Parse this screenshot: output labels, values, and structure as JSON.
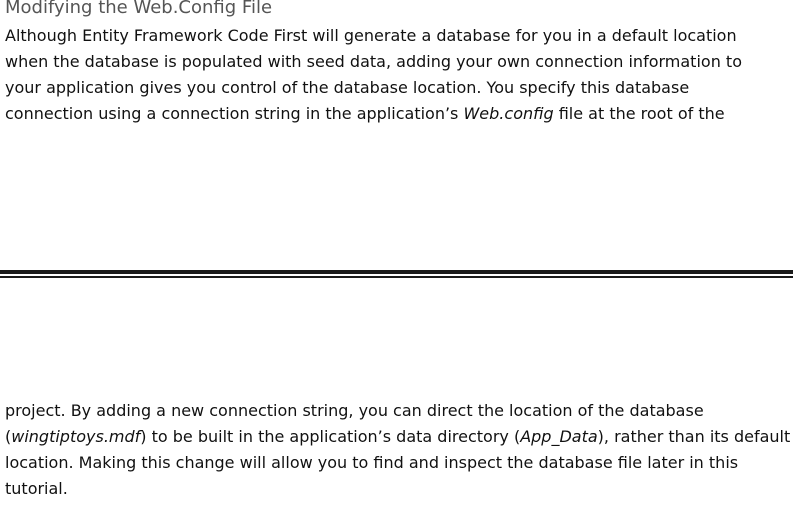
{
  "section": {
    "heading": "Modifying the Web.Config File"
  },
  "paragraph_top": {
    "lines": [
      "Although Entity Framework Code First will generate a database for you in a default location",
      "when the database is populated with seed data, adding your own connection information to",
      "your application gives you control of the database location. You specify this database",
      "connection using a connection string in the application’s ",
      "Web.config",
      " file at the root of the"
    ]
  },
  "paragraph_bottom": {
    "line1": "project. By adding a new connection string, you can direct the location of the database",
    "line2_open": "(",
    "line2_file": "wingtiptoys.mdf",
    "line2_mid": ") to be built in the application’s data directory (",
    "line2_dir": "App_Data",
    "line2_end": "), rather than its default",
    "line3": "location. Making this change will allow you to find and inspect the database file later in this",
    "line4": "tutorial."
  }
}
